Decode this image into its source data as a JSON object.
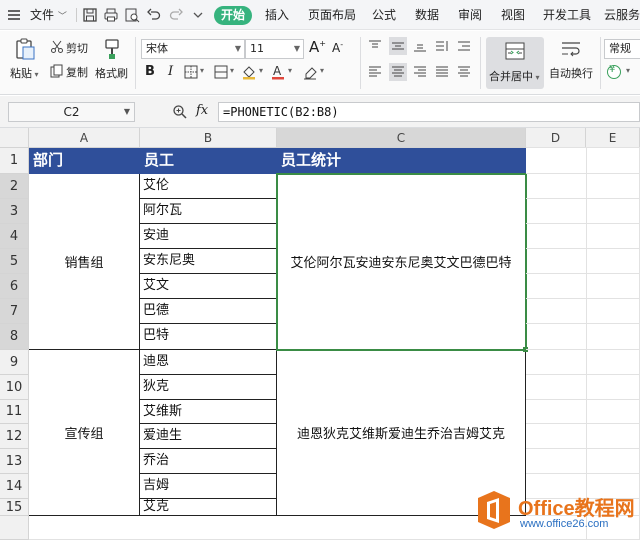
{
  "menubar": {
    "file_label": "文件",
    "tabs": [
      {
        "label": "开始",
        "active": true
      },
      {
        "label": "插入"
      },
      {
        "label": "页面布局"
      },
      {
        "label": "公式"
      },
      {
        "label": "数据"
      },
      {
        "label": "审阅"
      },
      {
        "label": "视图"
      },
      {
        "label": "开发工具"
      },
      {
        "label": "云服务"
      }
    ],
    "active_tab_color": "#36b37e"
  },
  "ribbon": {
    "paste_label": "粘贴",
    "cut_label": "剪切",
    "copy_label": "复制",
    "format_painter_label": "格式刷",
    "font_name": "宋体",
    "font_size": "11",
    "merge_label": "合并居中",
    "wrap_label": "自动换行",
    "number_format": "常规",
    "currency_symbol": "¥"
  },
  "formula_bar": {
    "name_box": "C2",
    "fx_label": "fx",
    "formula": "=PHONETIC(B2:B8)"
  },
  "sheet": {
    "columns": [
      "A",
      "B",
      "C",
      "D",
      "E"
    ],
    "rows": [
      "1",
      "2",
      "3",
      "4",
      "5",
      "6",
      "7",
      "8",
      "9",
      "10",
      "11",
      "12",
      "13",
      "14",
      "15"
    ],
    "header": {
      "dept": "部门",
      "employee": "员工",
      "stats": "员工统计"
    },
    "header_color": "#2f4f9a",
    "groups": [
      {
        "dept": "销售组",
        "summary": "艾伦阿尔瓦安迪安东尼奥艾文巴德巴特",
        "names": [
          "艾伦",
          "阿尔瓦",
          "安迪",
          "安东尼奥",
          "艾文",
          "巴德",
          "巴特"
        ]
      },
      {
        "dept": "宣传组",
        "summary": "迪恩狄克艾维斯爱迪生乔治吉姆艾克",
        "names": [
          "迪恩",
          "狄克",
          "艾维斯",
          "爱迪生",
          "乔治",
          "吉姆",
          "艾克"
        ]
      }
    ],
    "selection_color": "#3a8c45"
  },
  "watermark": {
    "title": "Office教程网",
    "url": "www.office26.com"
  }
}
